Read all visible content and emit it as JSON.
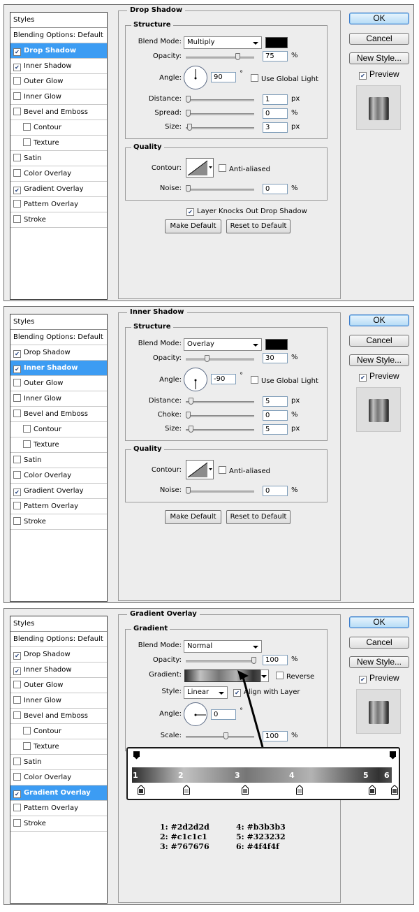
{
  "colors": {
    "panel_bg": "#ededed",
    "selection": "#3c9cf3",
    "gradient_stops": [
      "#2d2d2d",
      "#c1c1c1",
      "#767676",
      "#b3b3b3",
      "#323232",
      "#4f4f4f"
    ]
  },
  "common": {
    "styles_header": "Styles",
    "ok": "OK",
    "cancel": "Cancel",
    "new_style": "New Style...",
    "preview": "Preview",
    "make_default": "Make Default",
    "reset_default": "Reset to Default",
    "structure": "Structure",
    "quality": "Quality",
    "blend_mode": "Blend Mode:",
    "opacity": "Opacity:",
    "angle": "Angle:",
    "degree": "°",
    "use_global_light": "Use Global Light",
    "contour": "Contour:",
    "anti_aliased": "Anti-aliased",
    "noise": "Noise:",
    "px": "px",
    "pct": "%",
    "distance": "Distance:",
    "size": "Size:"
  },
  "styles_items": [
    "Blending Options: Default",
    "Drop Shadow",
    "Inner Shadow",
    "Outer Glow",
    "Inner Glow",
    "Bevel and Emboss",
    "Contour",
    "Texture",
    "Satin",
    "Color Overlay",
    "Gradient Overlay",
    "Pattern Overlay",
    "Stroke"
  ],
  "drop_shadow": {
    "title": "Drop Shadow",
    "blend_mode": "Multiply",
    "opacity": "75",
    "angle": "90",
    "distance": "1",
    "spread_label": "Spread:",
    "spread": "0",
    "size": "3",
    "noise": "0",
    "knockout": "Layer Knocks Out Drop Shadow",
    "color": "#000000"
  },
  "inner_shadow": {
    "title": "Inner Shadow",
    "blend_mode": "Overlay",
    "opacity": "30",
    "angle": "-90",
    "distance": "5",
    "choke_label": "Choke:",
    "choke": "0",
    "size": "5",
    "noise": "0",
    "color": "#000000"
  },
  "gradient_overlay": {
    "title": "Gradient Overlay",
    "group": "Gradient",
    "blend_mode": "Normal",
    "opacity": "100",
    "gradient_label": "Gradient:",
    "reverse": "Reverse",
    "style_label": "Style:",
    "style": "Linear",
    "align_with_layer": "Align with Layer",
    "angle": "0",
    "scale_label": "Scale:",
    "scale": "100",
    "stop_numbers": [
      "1",
      "2",
      "3",
      "4",
      "5",
      "6"
    ],
    "legend_left": [
      "1: #2d2d2d",
      "2: #c1c1c1",
      "3: #767676"
    ],
    "legend_right": [
      "4: #b3b3b3",
      "5: #323232",
      "6: #4f4f4f"
    ]
  }
}
